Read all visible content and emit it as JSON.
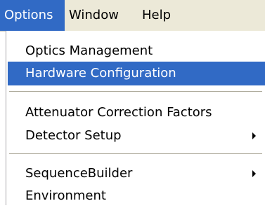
{
  "menubar": {
    "items": [
      {
        "label": "Options"
      },
      {
        "label": "Window"
      },
      {
        "label": "Help"
      }
    ]
  },
  "dropdown": {
    "items": [
      {
        "label": "Optics Management"
      },
      {
        "label": "Hardware Configuration"
      },
      {
        "label": "Attenuator Correction Factors"
      },
      {
        "label": "Detector Setup"
      },
      {
        "label": "SequenceBuilder"
      },
      {
        "label": "Environment"
      }
    ]
  },
  "colors": {
    "highlight": "#316ac5",
    "menubar_bg": "#ece9d8"
  },
  "icons": {
    "submenu": "submenu-arrow-icon"
  }
}
